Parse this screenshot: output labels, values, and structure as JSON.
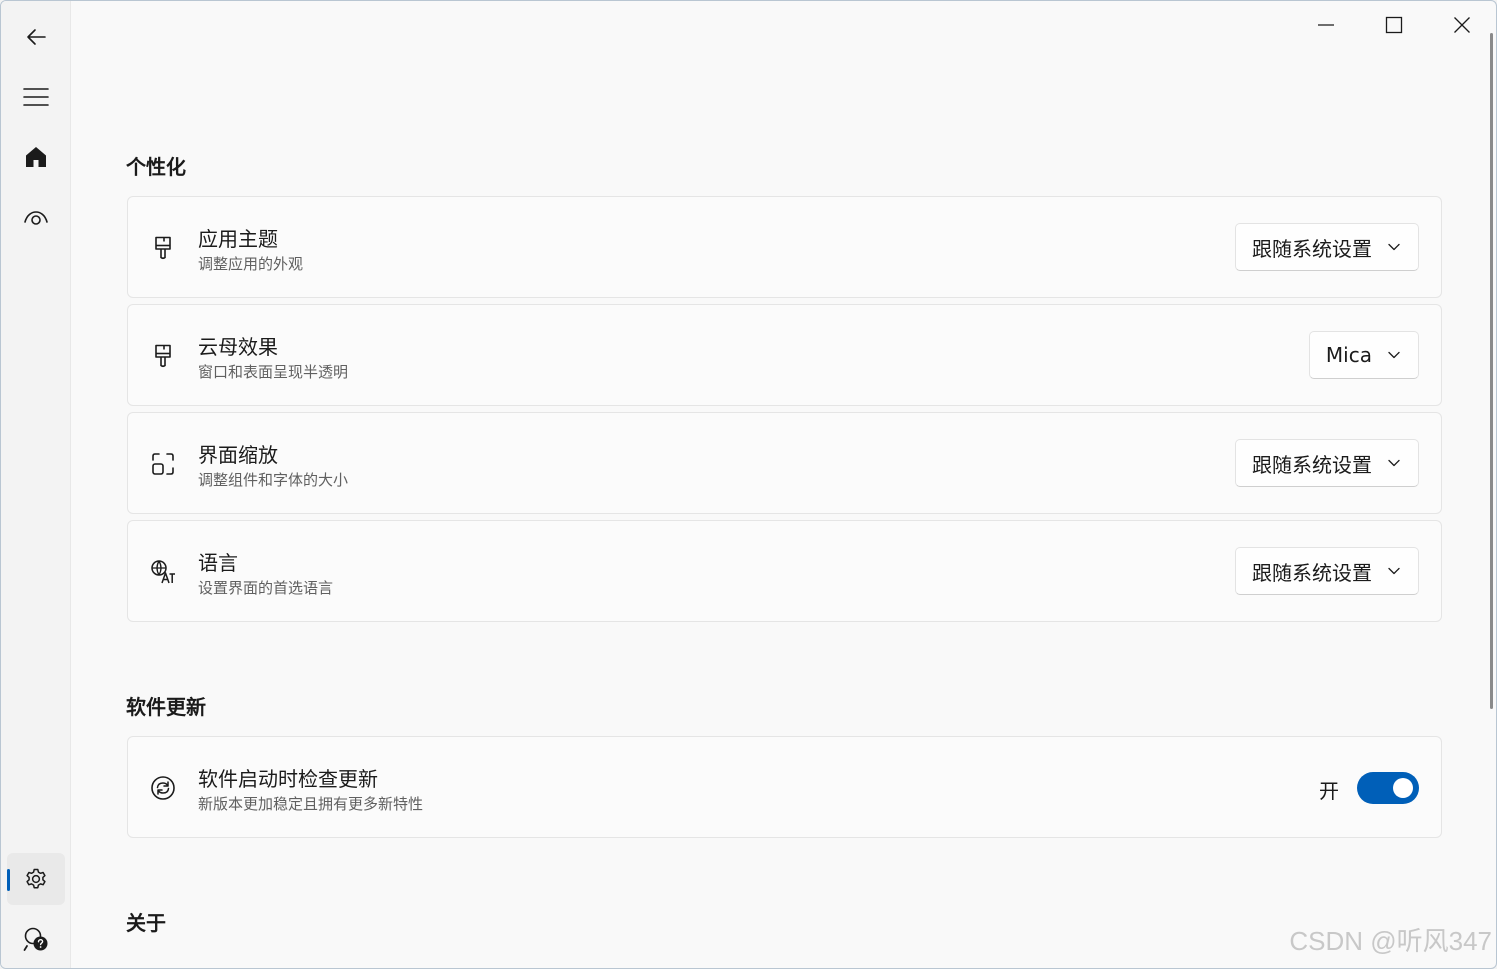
{
  "nav": {
    "items": [
      {
        "name": "back-icon",
        "selected": false
      },
      {
        "name": "menu-icon",
        "selected": false
      },
      {
        "name": "home-icon",
        "selected": false
      },
      {
        "name": "eye-icon",
        "selected": false
      },
      {
        "name": "settings-gear-icon",
        "selected": true
      },
      {
        "name": "help-search-icon",
        "selected": false
      }
    ]
  },
  "sections": {
    "personalization": {
      "title": "个性化",
      "cards": [
        {
          "icon": "brush-icon",
          "title": "应用主题",
          "desc": "调整应用的外观",
          "value": "跟随系统设置"
        },
        {
          "icon": "brush-icon",
          "title": "云母效果",
          "desc": "窗口和表面呈现半透明",
          "value": "Mica"
        },
        {
          "icon": "zoom-icon",
          "title": "界面缩放",
          "desc": "调整组件和字体的大小",
          "value": "跟随系统设置"
        },
        {
          "icon": "language-icon",
          "title": "语言",
          "desc": "设置界面的首选语言",
          "value": "跟随系统设置"
        }
      ]
    },
    "update": {
      "title": "软件更新",
      "card": {
        "icon": "sync-icon",
        "title": "软件启动时检查更新",
        "desc": "新版本更加稳定且拥有更多新特性",
        "toggle_label": "开",
        "toggle_on": true
      }
    },
    "about": {
      "title": "关于"
    }
  },
  "watermark": "CSDN @听风347",
  "colors": {
    "accent": "#005fb8",
    "background": "#f9f9f9",
    "nav_background": "#f3f3f3"
  }
}
